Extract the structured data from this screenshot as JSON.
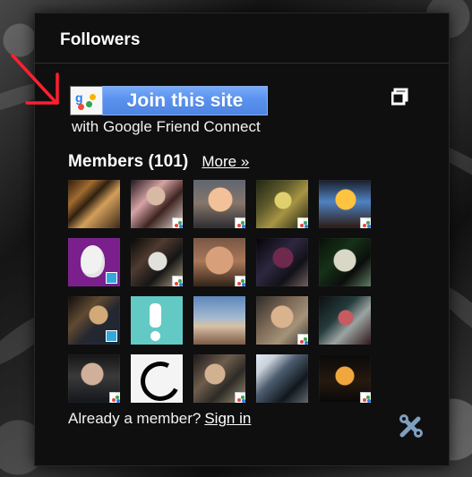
{
  "widget": {
    "title": "Followers",
    "join_button_label": "Join this site",
    "caption": "with Google Friend Connect",
    "members_title": "Members (101)",
    "more_link": "More »",
    "footer_text": "Already a member?",
    "sign_in_link": "Sign in"
  },
  "colors": {
    "panel_background": "#0f0f10",
    "join_button_blue": "#5a92ef",
    "annotation_red": "#ff1f2e"
  },
  "icons": {
    "arrow": "red-arrow-icon",
    "google_friend_connect": "google-friend-connect-icon",
    "external": "open-window-icon",
    "settings": "tools-icon"
  },
  "members": [
    {
      "name": "member-avatar-1"
    },
    {
      "name": "member-avatar-2"
    },
    {
      "name": "member-avatar-3"
    },
    {
      "name": "member-avatar-4"
    },
    {
      "name": "member-avatar-5"
    },
    {
      "name": "member-avatar-6"
    },
    {
      "name": "member-avatar-7"
    },
    {
      "name": "member-avatar-8"
    },
    {
      "name": "member-avatar-9"
    },
    {
      "name": "member-avatar-10"
    },
    {
      "name": "member-avatar-11"
    },
    {
      "name": "member-avatar-12"
    },
    {
      "name": "member-avatar-13"
    },
    {
      "name": "member-avatar-14"
    },
    {
      "name": "member-avatar-15"
    },
    {
      "name": "member-avatar-16"
    },
    {
      "name": "member-avatar-17"
    },
    {
      "name": "member-avatar-18"
    },
    {
      "name": "member-avatar-19"
    },
    {
      "name": "member-avatar-20"
    }
  ]
}
